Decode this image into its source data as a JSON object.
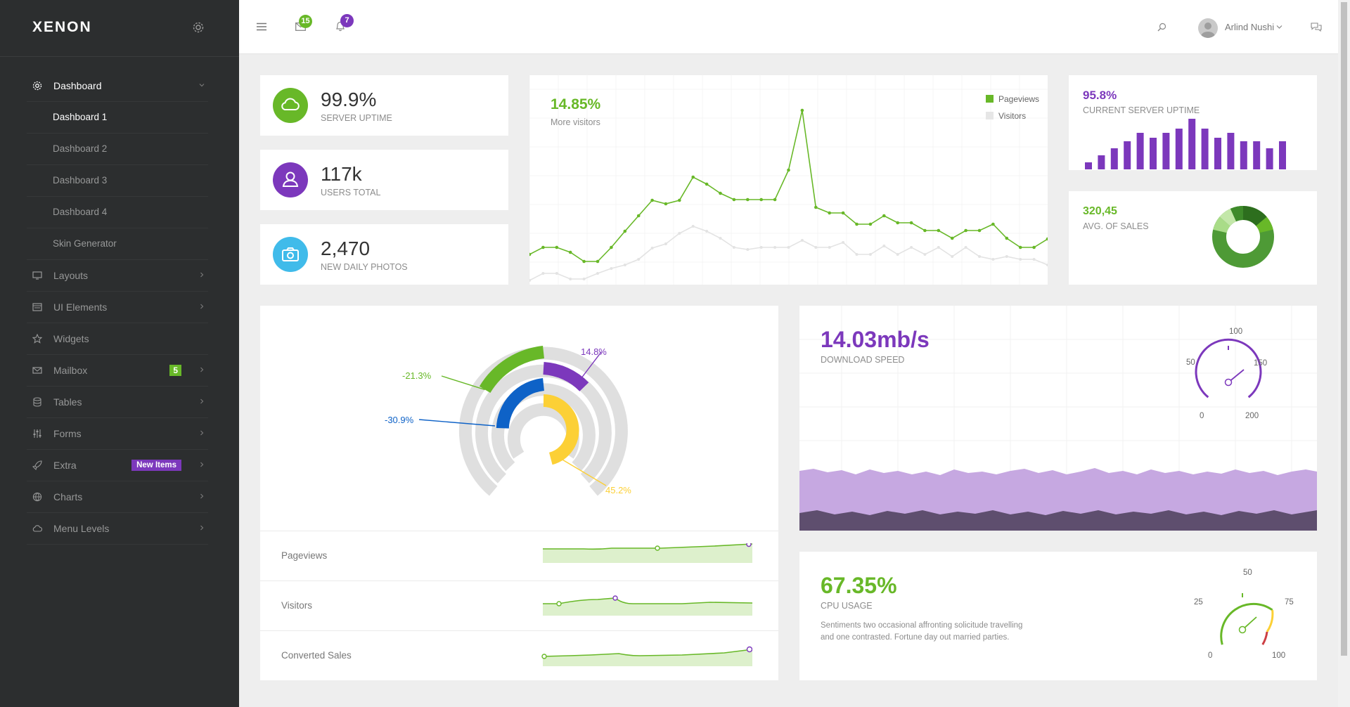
{
  "app": {
    "logo": "XENON"
  },
  "sidebar": {
    "items": [
      {
        "label": "Dashboard",
        "icon": "dashboard-gear-icon",
        "active": true
      },
      {
        "label": "Layouts",
        "icon": "monitor-icon"
      },
      {
        "label": "UI Elements",
        "icon": "ui-elements-icon"
      },
      {
        "label": "Widgets",
        "icon": "star-icon"
      },
      {
        "label": "Mailbox",
        "icon": "envelope-icon",
        "badge": "5"
      },
      {
        "label": "Tables",
        "icon": "database-icon"
      },
      {
        "label": "Forms",
        "icon": "sliders-icon"
      },
      {
        "label": "Extra",
        "icon": "rocket-icon",
        "badge": "New Items"
      },
      {
        "label": "Charts",
        "icon": "globe-icon"
      },
      {
        "label": "Menu Levels",
        "icon": "cloud-icon"
      }
    ],
    "submenu": [
      "Dashboard 1",
      "Dashboard 2",
      "Dashboard 3",
      "Dashboard 4",
      "Skin Generator"
    ]
  },
  "topbar": {
    "messages_count": "15",
    "notifications_count": "7",
    "user_name": "Arlind Nushi"
  },
  "stats": [
    {
      "value": "99.9%",
      "label": "SERVER UPTIME",
      "icon": "cloud-icon",
      "color": "#68b828"
    },
    {
      "value": "117k",
      "label": "USERS TOTAL",
      "icon": "user-icon",
      "color": "#7c38bc"
    },
    {
      "value": "2,470",
      "label": "NEW DAILY PHOTOS",
      "icon": "camera-icon",
      "color": "#0e62c7"
    }
  ],
  "visitors_chart": {
    "value": "14.85%",
    "label": "More visitors",
    "legend": [
      "Pageviews",
      "Visitors"
    ],
    "colors": {
      "pageviews": "#68b828",
      "visitors": "#e0e0e0"
    }
  },
  "uptime_card": {
    "value": "95.8%",
    "label": "CURRENT SERVER UPTIME"
  },
  "sales_card": {
    "value": "320,45",
    "label": "AVG. OF SALES"
  },
  "radial_chart": {
    "labels": {
      "purple": "14.8%",
      "green": "-21.3%",
      "blue": "-30.9%",
      "yellow": "45.2%"
    }
  },
  "sparklines": [
    {
      "label": "Pageviews"
    },
    {
      "label": "Visitors"
    },
    {
      "label": "Converted Sales"
    }
  ],
  "download_card": {
    "value": "14.03mb/s",
    "label": "DOWNLOAD SPEED",
    "gauge_ticks": [
      "0",
      "50",
      "100",
      "150",
      "200"
    ]
  },
  "cpu_card": {
    "value": "67.35%",
    "label": "CPU USAGE",
    "description": "Sentiments two occasional affronting solicitude travelling and one contrasted. Fortune day out married parties.",
    "gauge_ticks": [
      "0",
      "25",
      "50",
      "75",
      "100"
    ]
  }
}
